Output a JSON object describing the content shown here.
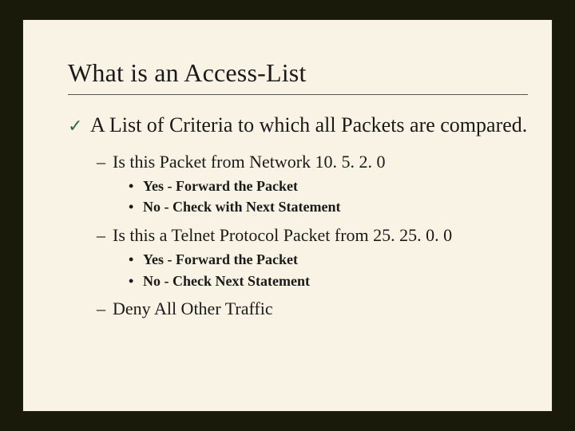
{
  "title": "What is an Access-List",
  "bullet": {
    "text": "A List of Criteria to which all Packets are compared.",
    "items": [
      {
        "text": "Is this Packet from Network 10. 5. 2. 0",
        "sub": [
          "Yes - Forward the Packet",
          "No - Check with Next Statement"
        ]
      },
      {
        "text": "Is this a Telnet Protocol Packet from 25. 25. 0. 0",
        "sub": [
          "Yes - Forward the Packet",
          "No - Check Next Statement"
        ]
      },
      {
        "text": "Deny All Other Traffic",
        "sub": []
      }
    ]
  }
}
